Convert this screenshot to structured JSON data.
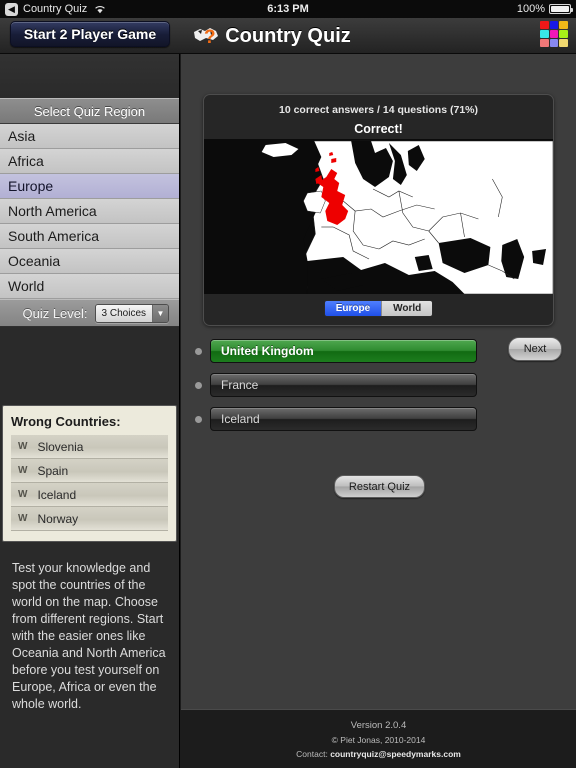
{
  "statusbar": {
    "back_icon": "back-chevron-icon",
    "app_name": "Country Quiz",
    "wifi_icon": "wifi-icon",
    "time": "6:13 PM",
    "battery_percent": "100%",
    "battery_icon": "battery-full-icon"
  },
  "navbar": {
    "start_two_player_label": "Start 2 Player Game",
    "globe_icon": "globe-question-icon",
    "title": "Country Quiz",
    "grid_icon": "color-grid-icon",
    "grid_colors": [
      "#f01818",
      "#1818e8",
      "#f0b818",
      "#38e8e8",
      "#f018b8",
      "#a8f018",
      "#f07878",
      "#8888f0",
      "#f0d870"
    ]
  },
  "sidebar": {
    "region_header": "Select Quiz Region",
    "regions": [
      {
        "label": "Asia",
        "selected": false
      },
      {
        "label": "Africa",
        "selected": false
      },
      {
        "label": "Europe",
        "selected": true
      },
      {
        "label": "North America",
        "selected": false
      },
      {
        "label": "South America",
        "selected": false
      },
      {
        "label": "Oceania",
        "selected": false
      },
      {
        "label": "World",
        "selected": false
      }
    ],
    "quiz_level": {
      "label": "Quiz Level:",
      "value": "3 Choices",
      "arrow_icon": "chevron-down-icon",
      "options": [
        "3 Choices"
      ]
    },
    "wrong_countries": {
      "title": "Wrong Countries:",
      "badge": "W",
      "items": [
        "Slovenia",
        "Spain",
        "Iceland",
        "Norway"
      ]
    },
    "about_text": "Test your knowledge and spot the countries of the world on the map. Choose from different regions. Start with the easier ones like Oceania and North America before you test yourself on Europe, Africa or even the whole world."
  },
  "main": {
    "score_line": "10 correct answers / 14 questions (71%)",
    "result_line": "Correct!",
    "map": {
      "region": "Europe",
      "highlight_country": "United Kingdom",
      "highlight_color": "#ee0000",
      "land_color": "#ffffff",
      "water_color": "#000000"
    },
    "map_toggle": [
      {
        "label": "Europe",
        "selected": true
      },
      {
        "label": "World",
        "selected": false
      }
    ],
    "answers": [
      {
        "label": "United Kingdom",
        "state": "correct"
      },
      {
        "label": "France",
        "state": "normal"
      },
      {
        "label": "Iceland",
        "state": "normal"
      }
    ],
    "next_label": "Next",
    "restart_label": "Restart Quiz"
  },
  "footer": {
    "version": "Version 2.0.4",
    "copyright": "© Piet Jonas, 2010-2014",
    "contact_prefix": "Contact: ",
    "contact_email": "countryquiz@speedymarks.com"
  }
}
